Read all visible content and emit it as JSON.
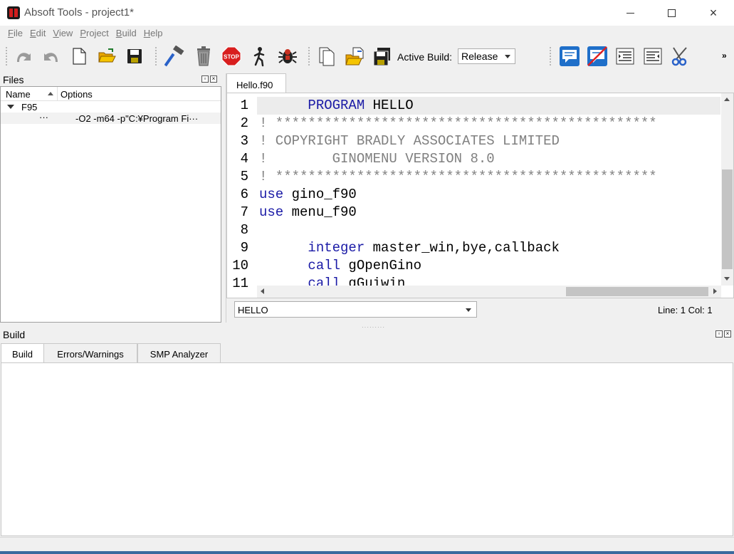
{
  "window": {
    "title": "Absoft Tools - project1*",
    "controls": {
      "minimize": "minimize",
      "maximize": "maximize",
      "close": "×"
    }
  },
  "menu": [
    {
      "key": "F",
      "rest": "ile"
    },
    {
      "key": "E",
      "rest": "dit"
    },
    {
      "key": "V",
      "rest": "iew"
    },
    {
      "key": "P",
      "rest": "roject"
    },
    {
      "key": "B",
      "rest": "uild"
    },
    {
      "key": "H",
      "rest": "elp"
    }
  ],
  "toolbar": {
    "active_build_label": "Active Build:",
    "active_build_value": "Release",
    "overflow": "»",
    "icons": [
      "undo-icon",
      "redo-icon",
      "new-file-icon",
      "open-folder-icon",
      "save-icon",
      "build-hammer-icon",
      "trash-icon",
      "stop-icon",
      "run-icon",
      "debug-icon",
      "copy-files-icon",
      "open-project-icon",
      "save-all-icon",
      "comment-icon",
      "uncomment-icon",
      "indent-icon",
      "outdent-icon",
      "cut-icon"
    ],
    "stop_text": "STOP"
  },
  "files_panel": {
    "title": "Files",
    "columns": {
      "name": "Name",
      "options": "Options"
    },
    "tree": [
      {
        "label": "F95",
        "expanded": true
      },
      {
        "label": "···",
        "options": "-O2 -m64 -p\"C:¥Program Fi···"
      }
    ]
  },
  "editor": {
    "tab": "Hello.f90",
    "line_numbers": [
      "1",
      "2",
      "3",
      "4",
      "5",
      "6",
      "7",
      "8",
      "9",
      "10",
      "11"
    ],
    "lines": {
      "l1_indent": "      ",
      "l1_kw": "PROGRAM",
      "l1_rest": " HELLO",
      "l2": "! ***********************************************",
      "l3": "! COPYRIGHT BRADLY ASSOCIATES LIMITED",
      "l4": "!        GINOMENU VERSION 8.0",
      "l5": "! ***********************************************",
      "l6_kw": "use",
      "l6_rest": " gino_f90",
      "l7_kw": "use",
      "l7_rest": " menu_f90",
      "l8": "",
      "l9_indent": "      ",
      "l9_kw": "integer",
      "l9_rest": " master_win,bye,callback",
      "l10_indent": "      ",
      "l10_kw": "call",
      "l10_rest": " gOpenGino",
      "l11_indent": "      ",
      "l11_kw": "call",
      "l11_rest": " gGuiwin"
    },
    "function_select": "HELLO",
    "position": "Line: 1  Col: 1"
  },
  "build_panel": {
    "title": "Build",
    "tabs": [
      "Build",
      "Errors/Warnings",
      "SMP Analyzer"
    ],
    "active_tab": "Build",
    "output": ""
  }
}
